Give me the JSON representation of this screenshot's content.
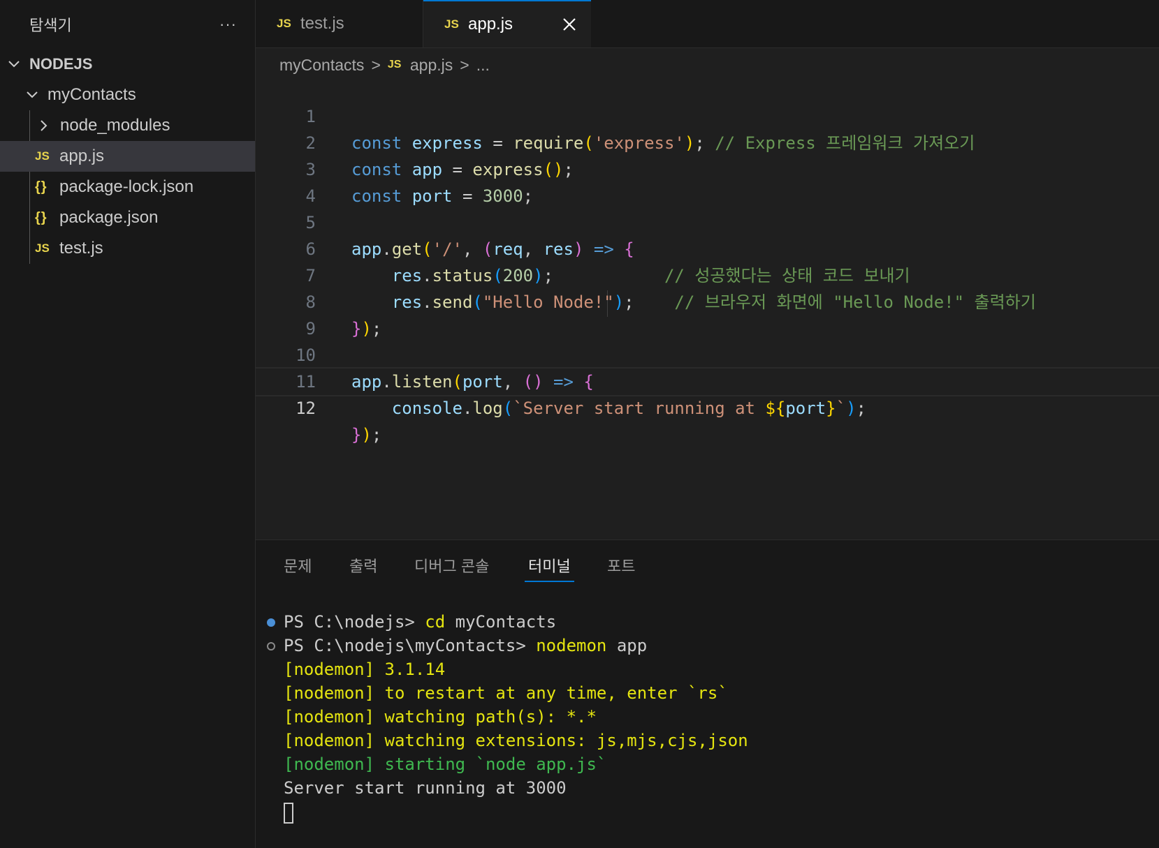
{
  "explorer": {
    "title": "탐색기",
    "more": "···",
    "root": "NODEJS",
    "folder": "myContacts",
    "items": [
      {
        "label": "node_modules"
      },
      {
        "label": "app.js",
        "icon": "JS"
      },
      {
        "label": "package-lock.json",
        "icon": "{}"
      },
      {
        "label": "package.json",
        "icon": "{}"
      },
      {
        "label": "test.js",
        "icon": "JS"
      }
    ]
  },
  "tabs": [
    {
      "icon": "JS",
      "label": "test.js"
    },
    {
      "icon": "JS",
      "label": "app.js"
    }
  ],
  "breadcrumb": {
    "folder": "myContacts",
    "sep": ">",
    "icon": "JS",
    "file": "app.js",
    "more": "..."
  },
  "editor": {
    "line_numbers": [
      "1",
      "2",
      "3",
      "4",
      "5",
      "6",
      "7",
      "8",
      "9",
      "10",
      "11",
      "12"
    ],
    "current_line": "12"
  },
  "panel": {
    "tabs": [
      "문제",
      "출력",
      "디버그 콘솔",
      "터미널",
      "포트"
    ],
    "active_tab": "터미널"
  },
  "terminal": {
    "lines": [
      {
        "prompt": "PS C:\\nodejs> ",
        "cmd": "cd",
        "arg": " myContacts"
      },
      {
        "prompt": "PS C:\\nodejs\\myContacts> ",
        "cmd": "nodemon",
        "arg": " app"
      },
      {
        "text": "[nodemon] 3.1.14"
      },
      {
        "text": "[nodemon] to restart at any time, enter `rs`"
      },
      {
        "text": "[nodemon] watching path(s): *.*"
      },
      {
        "text": "[nodemon] watching extensions: js,mjs,cjs,json"
      },
      {
        "text": "[nodemon] starting `node app.js`"
      },
      {
        "text": "Server start running at 3000"
      }
    ]
  },
  "colors": {
    "accent": "#0078d4",
    "js_icon": "#e8d44d",
    "keyword": "#569cd6",
    "string": "#ce9178",
    "comment": "#6a9955"
  }
}
